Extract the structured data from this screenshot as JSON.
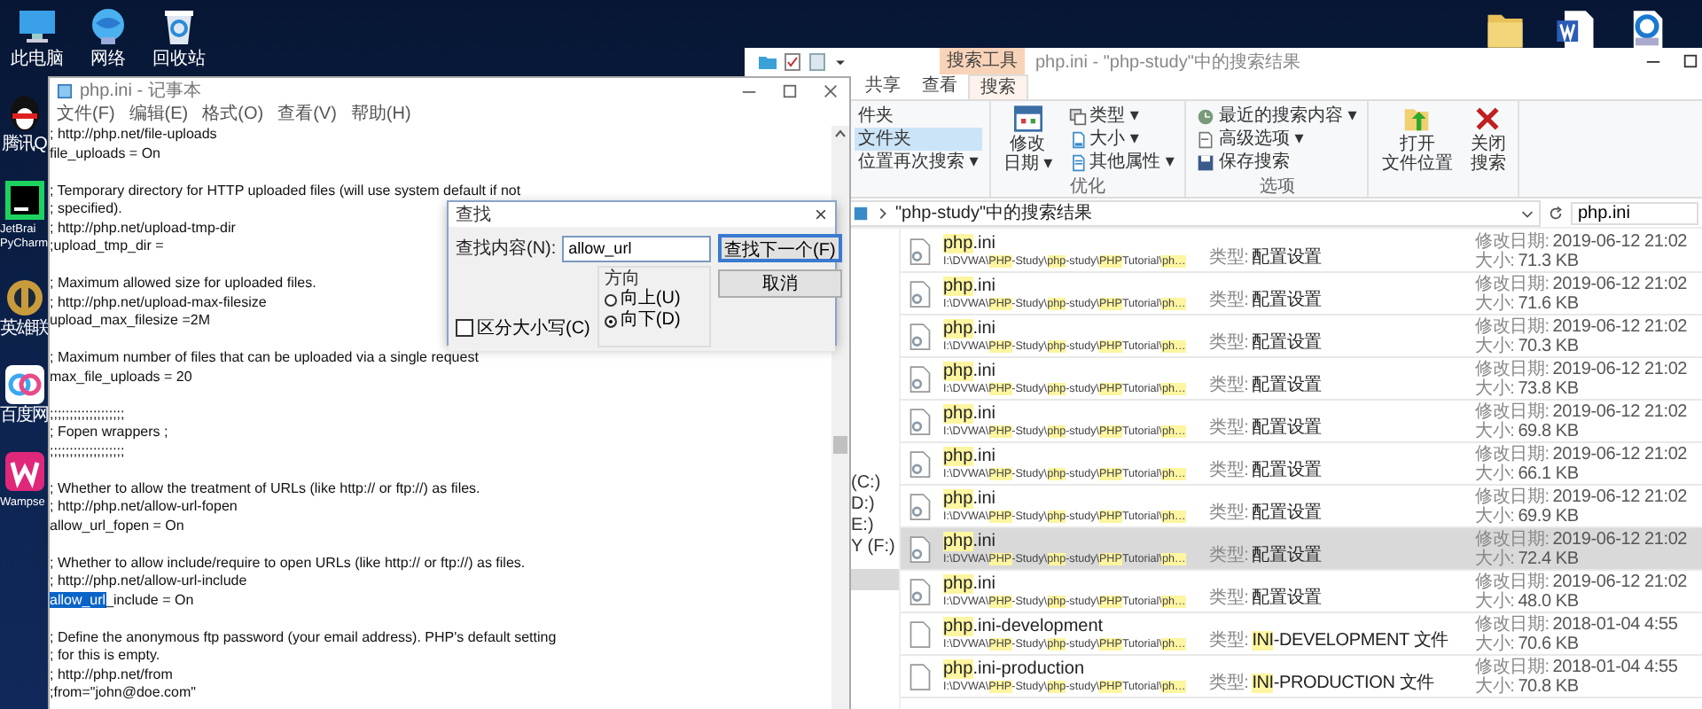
{
  "desktop": {
    "top_icons": [
      {
        "label": "此电脑",
        "kind": "computer"
      },
      {
        "label": "网络",
        "kind": "network"
      },
      {
        "label": "回收站",
        "kind": "recycle"
      }
    ],
    "side_icons": [
      {
        "label": "腾讯Q",
        "kind": "penguin"
      },
      {
        "label": "JetBrai PyCharm",
        "kind": "ide"
      },
      {
        "label": "英雄联",
        "kind": "game"
      },
      {
        "label": "百度网",
        "kind": "cloud"
      },
      {
        "label": "Wampse",
        "kind": "server"
      }
    ],
    "corner_icons": [
      {
        "kind": "folder"
      },
      {
        "kind": "word"
      },
      {
        "kind": "pdf"
      }
    ]
  },
  "explorer": {
    "context_tab": "搜索工具",
    "title": "php.ini - \"php-study\"中的搜索结果",
    "tabs": [
      {
        "label": "共享",
        "selected": false
      },
      {
        "label": "查看",
        "selected": false
      },
      {
        "label": "搜索",
        "selected": true
      }
    ],
    "ribbon": {
      "location_items": [
        {
          "label": "件夹",
          "selected": false
        },
        {
          "label": "文件夹",
          "selected": true
        },
        {
          "label": "位置再次搜索 ▾",
          "selected": false
        }
      ],
      "groups": [
        {
          "label": "优化",
          "large": [
            {
              "lines": [
                "修改",
                "日期 ▾"
              ],
              "kind": "calendar"
            }
          ],
          "small": [
            {
              "label": "类型 ▾",
              "kind": "type"
            },
            {
              "label": "大小 ▾",
              "kind": "size"
            },
            {
              "label": "其他属性 ▾",
              "kind": "props"
            }
          ]
        },
        {
          "label": "选项",
          "small": [
            {
              "label": "最近的搜索内容 ▾",
              "kind": "recent"
            },
            {
              "label": "高级选项 ▾",
              "kind": "advanced"
            },
            {
              "label": "保存搜索",
              "kind": "save"
            }
          ]
        }
      ],
      "actions": [
        {
          "lines": [
            "打开",
            "文件位置"
          ],
          "kind": "open"
        },
        {
          "lines": [
            "关闭",
            "搜索"
          ],
          "kind": "close"
        }
      ]
    },
    "address": "\"php-study\"中的搜索结果",
    "search_value": "php.ini",
    "nav_items": [
      {
        "label": "(C:)",
        "selected": false
      },
      {
        "label": "D:)",
        "selected": false
      },
      {
        "label": "E:)",
        "selected": false
      },
      {
        "label": "Y (F:)",
        "selected": false
      },
      {
        "selected": true
      }
    ],
    "files": [
      {
        "kind": "ini",
        "selected": false,
        "name": [
          {
            "text": "php",
            "highlight": true
          },
          {
            "text": ".ini",
            "highlight": false
          }
        ],
        "path": [
          {
            "text": "I:\\DVWA\\",
            "highlight": false
          },
          {
            "text": "PHP",
            "highlight": true
          },
          {
            "text": "-Study\\",
            "highlight": false
          },
          {
            "text": "php",
            "highlight": true
          },
          {
            "text": "-study\\",
            "highlight": false
          },
          {
            "text": "PHP",
            "highlight": true
          },
          {
            "text": "Tutorial\\",
            "highlight": false
          },
          {
            "text": "ph…",
            "highlight": true
          }
        ],
        "type_label": "类型:",
        "type": [
          {
            "text": "配置设置",
            "highlight": false
          }
        ],
        "modified_label": "修改日期:",
        "modified": "2019-06-12 21:02",
        "size_label": "大小:",
        "size": "71.3 KB"
      },
      {
        "kind": "ini",
        "selected": false,
        "name": [
          {
            "text": "php",
            "highlight": true
          },
          {
            "text": ".ini",
            "highlight": false
          }
        ],
        "path": [
          {
            "text": "I:\\DVWA\\",
            "highlight": false
          },
          {
            "text": "PHP",
            "highlight": true
          },
          {
            "text": "-Study\\",
            "highlight": false
          },
          {
            "text": "php",
            "highlight": true
          },
          {
            "text": "-study\\",
            "highlight": false
          },
          {
            "text": "PHP",
            "highlight": true
          },
          {
            "text": "Tutorial\\",
            "highlight": false
          },
          {
            "text": "ph…",
            "highlight": true
          }
        ],
        "type_label": "类型:",
        "type": [
          {
            "text": "配置设置",
            "highlight": false
          }
        ],
        "modified_label": "修改日期:",
        "modified": "2019-06-12 21:02",
        "size_label": "大小:",
        "size": "71.6 KB"
      },
      {
        "kind": "ini",
        "selected": false,
        "name": [
          {
            "text": "php",
            "highlight": true
          },
          {
            "text": ".ini",
            "highlight": false
          }
        ],
        "path": [
          {
            "text": "I:\\DVWA\\",
            "highlight": false
          },
          {
            "text": "PHP",
            "highlight": true
          },
          {
            "text": "-Study\\",
            "highlight": false
          },
          {
            "text": "php",
            "highlight": true
          },
          {
            "text": "-study\\",
            "highlight": false
          },
          {
            "text": "PHP",
            "highlight": true
          },
          {
            "text": "Tutorial\\",
            "highlight": false
          },
          {
            "text": "ph…",
            "highlight": true
          }
        ],
        "type_label": "类型:",
        "type": [
          {
            "text": "配置设置",
            "highlight": false
          }
        ],
        "modified_label": "修改日期:",
        "modified": "2019-06-12 21:02",
        "size_label": "大小:",
        "size": "70.3 KB"
      },
      {
        "kind": "ini",
        "selected": false,
        "name": [
          {
            "text": "php",
            "highlight": true
          },
          {
            "text": ".ini",
            "highlight": false
          }
        ],
        "path": [
          {
            "text": "I:\\DVWA\\",
            "highlight": false
          },
          {
            "text": "PHP",
            "highlight": true
          },
          {
            "text": "-Study\\",
            "highlight": false
          },
          {
            "text": "php",
            "highlight": true
          },
          {
            "text": "-study\\",
            "highlight": false
          },
          {
            "text": "PHP",
            "highlight": true
          },
          {
            "text": "Tutorial\\",
            "highlight": false
          },
          {
            "text": "ph…",
            "highlight": true
          }
        ],
        "type_label": "类型:",
        "type": [
          {
            "text": "配置设置",
            "highlight": false
          }
        ],
        "modified_label": "修改日期:",
        "modified": "2019-06-12 21:02",
        "size_label": "大小:",
        "size": "73.8 KB"
      },
      {
        "kind": "ini",
        "selected": false,
        "name": [
          {
            "text": "php",
            "highlight": true
          },
          {
            "text": ".ini",
            "highlight": false
          }
        ],
        "path": [
          {
            "text": "I:\\DVWA\\",
            "highlight": false
          },
          {
            "text": "PHP",
            "highlight": true
          },
          {
            "text": "-Study\\",
            "highlight": false
          },
          {
            "text": "php",
            "highlight": true
          },
          {
            "text": "-study\\",
            "highlight": false
          },
          {
            "text": "PHP",
            "highlight": true
          },
          {
            "text": "Tutorial\\",
            "highlight": false
          },
          {
            "text": "ph…",
            "highlight": true
          }
        ],
        "type_label": "类型:",
        "type": [
          {
            "text": "配置设置",
            "highlight": false
          }
        ],
        "modified_label": "修改日期:",
        "modified": "2019-06-12 21:02",
        "size_label": "大小:",
        "size": "69.8 KB"
      },
      {
        "kind": "ini",
        "selected": false,
        "name": [
          {
            "text": "php",
            "highlight": true
          },
          {
            "text": ".ini",
            "highlight": false
          }
        ],
        "path": [
          {
            "text": "I:\\DVWA\\",
            "highlight": false
          },
          {
            "text": "PHP",
            "highlight": true
          },
          {
            "text": "-Study\\",
            "highlight": false
          },
          {
            "text": "php",
            "highlight": true
          },
          {
            "text": "-study\\",
            "highlight": false
          },
          {
            "text": "PHP",
            "highlight": true
          },
          {
            "text": "Tutorial\\",
            "highlight": false
          },
          {
            "text": "ph…",
            "highlight": true
          }
        ],
        "type_label": "类型:",
        "type": [
          {
            "text": "配置设置",
            "highlight": false
          }
        ],
        "modified_label": "修改日期:",
        "modified": "2019-06-12 21:02",
        "size_label": "大小:",
        "size": "66.1 KB"
      },
      {
        "kind": "ini",
        "selected": false,
        "name": [
          {
            "text": "php",
            "highlight": true
          },
          {
            "text": ".ini",
            "highlight": false
          }
        ],
        "path": [
          {
            "text": "I:\\DVWA\\",
            "highlight": false
          },
          {
            "text": "PHP",
            "highlight": true
          },
          {
            "text": "-Study\\",
            "highlight": false
          },
          {
            "text": "php",
            "highlight": true
          },
          {
            "text": "-study\\",
            "highlight": false
          },
          {
            "text": "PHP",
            "highlight": true
          },
          {
            "text": "Tutorial\\",
            "highlight": false
          },
          {
            "text": "ph…",
            "highlight": true
          }
        ],
        "type_label": "类型:",
        "type": [
          {
            "text": "配置设置",
            "highlight": false
          }
        ],
        "modified_label": "修改日期:",
        "modified": "2019-06-12 21:02",
        "size_label": "大小:",
        "size": "69.9 KB"
      },
      {
        "kind": "ini",
        "selected": true,
        "name": [
          {
            "text": "php",
            "highlight": true
          },
          {
            "text": ".ini",
            "highlight": false
          }
        ],
        "path": [
          {
            "text": "I:\\DVWA\\",
            "highlight": false
          },
          {
            "text": "PHP",
            "highlight": true
          },
          {
            "text": "-Study\\",
            "highlight": false
          },
          {
            "text": "php",
            "highlight": true
          },
          {
            "text": "-study\\",
            "highlight": false
          },
          {
            "text": "PHP",
            "highlight": true
          },
          {
            "text": "Tutorial\\",
            "highlight": false
          },
          {
            "text": "ph…",
            "highlight": true
          }
        ],
        "type_label": "类型:",
        "type": [
          {
            "text": "配置设置",
            "highlight": false
          }
        ],
        "modified_label": "修改日期:",
        "modified": "2019-06-12 21:02",
        "size_label": "大小:",
        "size": "72.4 KB"
      },
      {
        "kind": "ini",
        "selected": false,
        "name": [
          {
            "text": "php",
            "highlight": true
          },
          {
            "text": ".ini",
            "highlight": false
          }
        ],
        "path": [
          {
            "text": "I:\\DVWA\\",
            "highlight": false
          },
          {
            "text": "PHP",
            "highlight": true
          },
          {
            "text": "-Study\\",
            "highlight": false
          },
          {
            "text": "php",
            "highlight": true
          },
          {
            "text": "-study\\",
            "highlight": false
          },
          {
            "text": "PHP",
            "highlight": true
          },
          {
            "text": "Tutorial\\",
            "highlight": false
          },
          {
            "text": "ph…",
            "highlight": true
          }
        ],
        "type_label": "类型:",
        "type": [
          {
            "text": "配置设置",
            "highlight": false
          }
        ],
        "modified_label": "修改日期:",
        "modified": "2019-06-12 21:02",
        "size_label": "大小:",
        "size": "48.0 KB"
      },
      {
        "kind": "plain",
        "selected": false,
        "name": [
          {
            "text": "php",
            "highlight": true
          },
          {
            "text": ".ini-development",
            "highlight": false
          }
        ],
        "path": [
          {
            "text": "I:\\DVWA\\",
            "highlight": false
          },
          {
            "text": "PHP",
            "highlight": true
          },
          {
            "text": "-Study\\",
            "highlight": false
          },
          {
            "text": "php",
            "highlight": true
          },
          {
            "text": "-study\\",
            "highlight": false
          },
          {
            "text": "PHP",
            "highlight": true
          },
          {
            "text": "Tutorial\\",
            "highlight": false
          },
          {
            "text": "ph…",
            "highlight": true
          }
        ],
        "type_label": "类型:",
        "type": [
          {
            "text": "INI",
            "highlight": true
          },
          {
            "text": "-DEVELOPMENT 文件",
            "highlight": false
          }
        ],
        "modified_label": "修改日期:",
        "modified": "2018-01-04 4:55",
        "size_label": "大小:",
        "size": "70.6 KB"
      },
      {
        "kind": "plain",
        "selected": false,
        "name": [
          {
            "text": "php",
            "highlight": true
          },
          {
            "text": ".ini-production",
            "highlight": false
          }
        ],
        "path": [
          {
            "text": "I:\\DVWA\\",
            "highlight": false
          },
          {
            "text": "PHP",
            "highlight": true
          },
          {
            "text": "-Study\\",
            "highlight": false
          },
          {
            "text": "php",
            "highlight": true
          },
          {
            "text": "-study\\",
            "highlight": false
          },
          {
            "text": "PHP",
            "highlight": true
          },
          {
            "text": "Tutorial\\",
            "highlight": false
          },
          {
            "text": "ph…",
            "highlight": true
          }
        ],
        "type_label": "类型:",
        "type": [
          {
            "text": "INI",
            "highlight": true
          },
          {
            "text": "-PRODUCTION 文件",
            "highlight": false
          }
        ],
        "modified_label": "修改日期:",
        "modified": "2018-01-04 4:55",
        "size_label": "大小:",
        "size": "70.8 KB"
      }
    ]
  },
  "notepad": {
    "title": "php.ini - 记事本",
    "menu": [
      "文件(F)",
      "编辑(E)",
      "格式(O)",
      "查看(V)",
      "帮助(H)"
    ],
    "paragraphs": [
      {
        "lines": [
          {
            "text": "; http://php.net/file-uploads"
          },
          {
            "text": "file_uploads = On"
          }
        ]
      },
      {
        "lines": [
          {
            "text": "; Temporary directory for HTTP uploaded files (will use system default if not"
          },
          {
            "text": "; specified)."
          },
          {
            "text": "; http://php.net/upload-tmp-dir"
          },
          {
            "text": ";upload_tmp_dir ="
          }
        ]
      },
      {
        "lines": [
          {
            "text": "; Maximum allowed size for uploaded files."
          },
          {
            "text": "; http://php.net/upload-max-filesize"
          },
          {
            "text": "upload_max_filesize =2M"
          }
        ]
      },
      {
        "lines": [
          {
            "text": "; Maximum number of files that can be uploaded via a single request"
          },
          {
            "text": "max_file_uploads = 20"
          }
        ]
      },
      {
        "lines": [
          {
            "text": ";;;;;;;;;;;;;;;;;;;"
          },
          {
            "text": "; Fopen wrappers ;"
          },
          {
            "text": ";;;;;;;;;;;;;;;;;;;"
          }
        ]
      },
      {
        "lines": [
          {
            "text": "; Whether to allow the treatment of URLs (like http:// or ftp://) as files."
          },
          {
            "text": "; http://php.net/allow-url-fopen"
          },
          {
            "text": "allow_url_fopen = On"
          }
        ]
      },
      {
        "lines": [
          {
            "text": "; Whether to allow include/require to open URLs (like http:// or ftp://) as files."
          },
          {
            "text": "; http://php.net/allow-url-include"
          },
          {
            "match": "allow_url",
            "text": "_include = On"
          }
        ]
      },
      {
        "lines": [
          {
            "text": "; Define the anonymous ftp password (your email address). PHP's default setting"
          },
          {
            "text": "; for this is empty."
          },
          {
            "text": "; http://php.net/from"
          },
          {
            "text": ";from=\"john@doe.com\""
          }
        ]
      }
    ]
  },
  "find_dialog": {
    "title": "查找",
    "find_label": "查找内容(N):",
    "find_value": "allow_url",
    "buttons": [
      {
        "label": "查找下一个(F)",
        "default": true
      },
      {
        "label": "取消",
        "default": false
      }
    ],
    "direction_label": "方向",
    "directions": [
      {
        "label": "向上(U)",
        "selected": false
      },
      {
        "label": "向下(D)",
        "selected": true
      }
    ],
    "match_case": {
      "label": "区分大小写(C)",
      "checked": false
    }
  }
}
